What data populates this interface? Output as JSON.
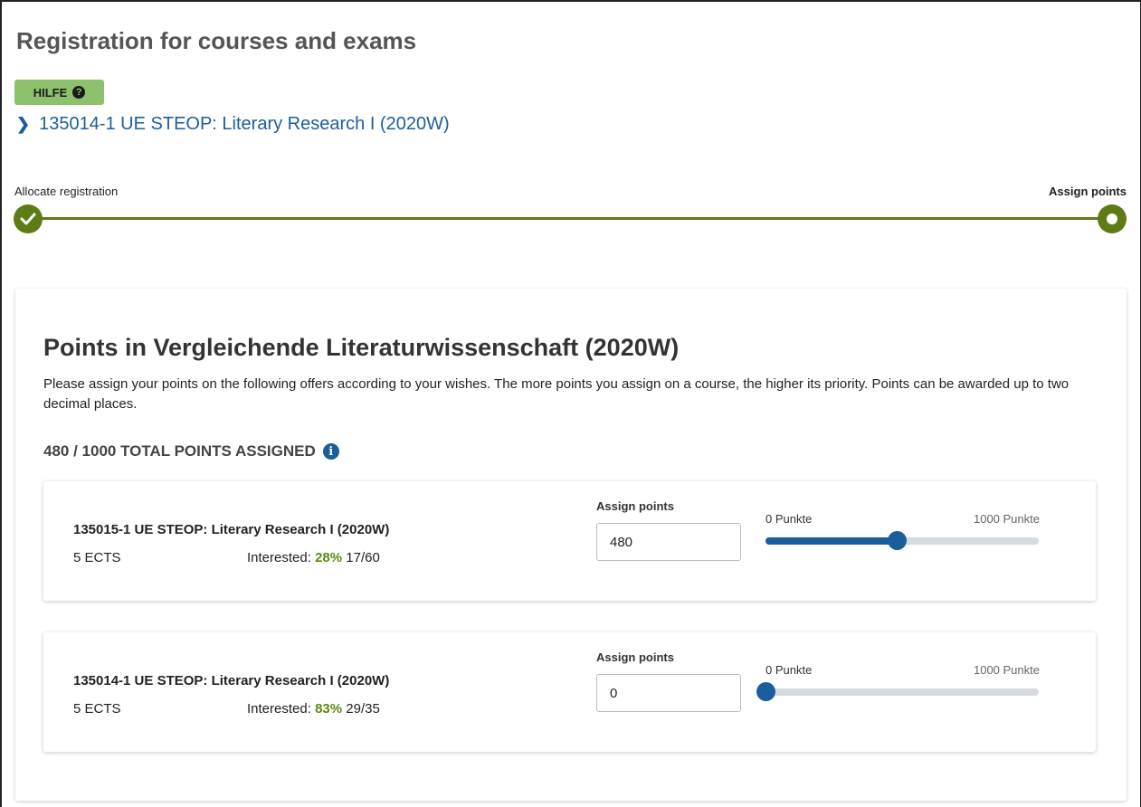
{
  "header": {
    "title": "Registration for courses and exams",
    "help_label": "HILFE",
    "help_icon": "question-circle-icon",
    "course_link": "135014-1 UE STEOP: Literary Research I (2020W)"
  },
  "stepper": {
    "step1_label": "Allocate registration",
    "step2_label": "Assign points",
    "accent": "#5e7b14"
  },
  "points_card": {
    "title": "Points in Vergleichende Literaturwissenschaft (2020W)",
    "description": "Please assign your points on the following offers according to your wishes. The more points you assign on a course, the higher its priority. Points can be awarded up to two decimal places.",
    "total_assigned": "480 / 1000 TOTAL POINTS ASSIGNED",
    "info_icon": "info-circle-icon"
  },
  "offers": [
    {
      "name": "135015-1 UE STEOP: Literary Research I (2020W)",
      "ects": "5 ECTS",
      "interested_label": "Interested:",
      "interested_pct": "28%",
      "interested_count": "17/60",
      "assign_label": "Assign points",
      "points_value": "480",
      "slider_min": "0 Punkte",
      "slider_max": "1000 Punkte",
      "slider_fraction": 0.48
    },
    {
      "name": "135014-1 UE STEOP: Literary Research I (2020W)",
      "ects": "5 ECTS",
      "interested_label": "Interested:",
      "interested_pct": "83%",
      "interested_count": "29/35",
      "assign_label": "Assign points",
      "points_value": "0",
      "slider_min": "0 Punkte",
      "slider_max": "1000 Punkte",
      "slider_fraction": 0
    }
  ],
  "colors": {
    "link": "#1b5e9c",
    "help_bg": "#8dc16b",
    "percent": "#5e8a14"
  }
}
